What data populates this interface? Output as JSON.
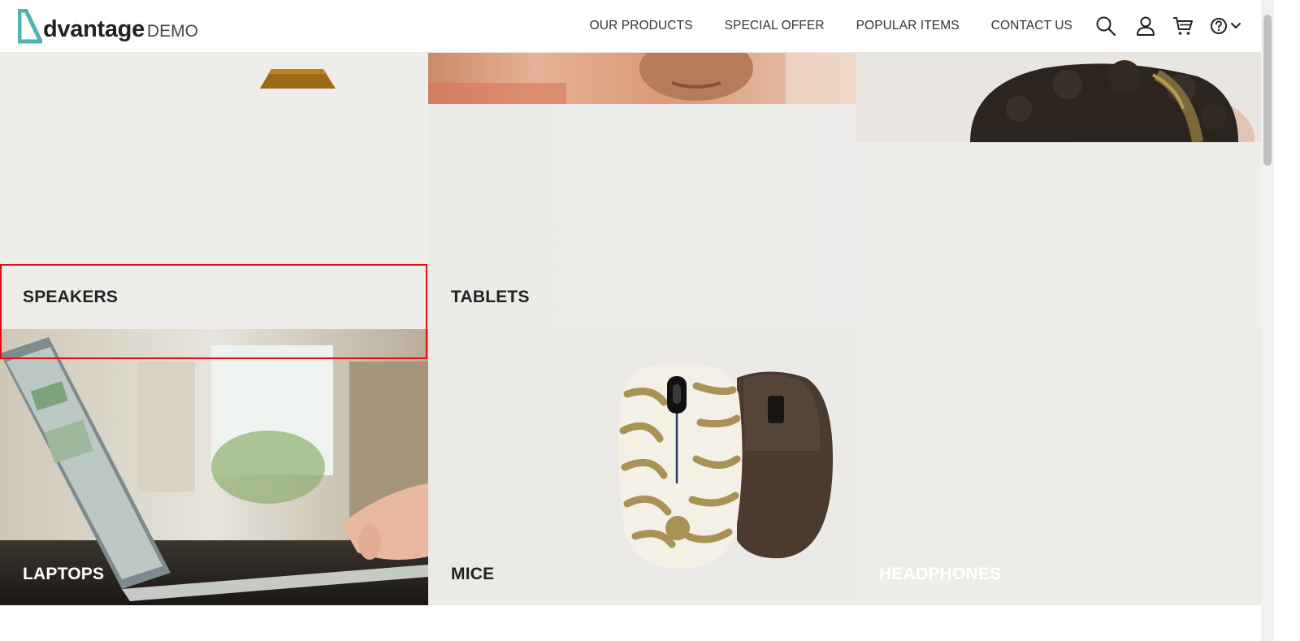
{
  "header": {
    "logo_word": "dvantage",
    "logo_suffix": "DEMO",
    "nav": [
      "OUR PRODUCTS",
      "SPECIAL OFFER",
      "POPULAR ITEMS",
      "CONTACT US"
    ],
    "icons": [
      "search-icon",
      "user-icon",
      "cart-icon",
      "help-icon",
      "chevron-down-icon"
    ]
  },
  "categories": {
    "speakers": "SPEAKERS",
    "tablets": "TABLETS",
    "laptops": "LAPTOPS",
    "mice": "MICE",
    "headphones": "HEADPHONES"
  },
  "colors": {
    "brand_teal": "#4fb3b0",
    "highlight_red": "#e01010"
  }
}
